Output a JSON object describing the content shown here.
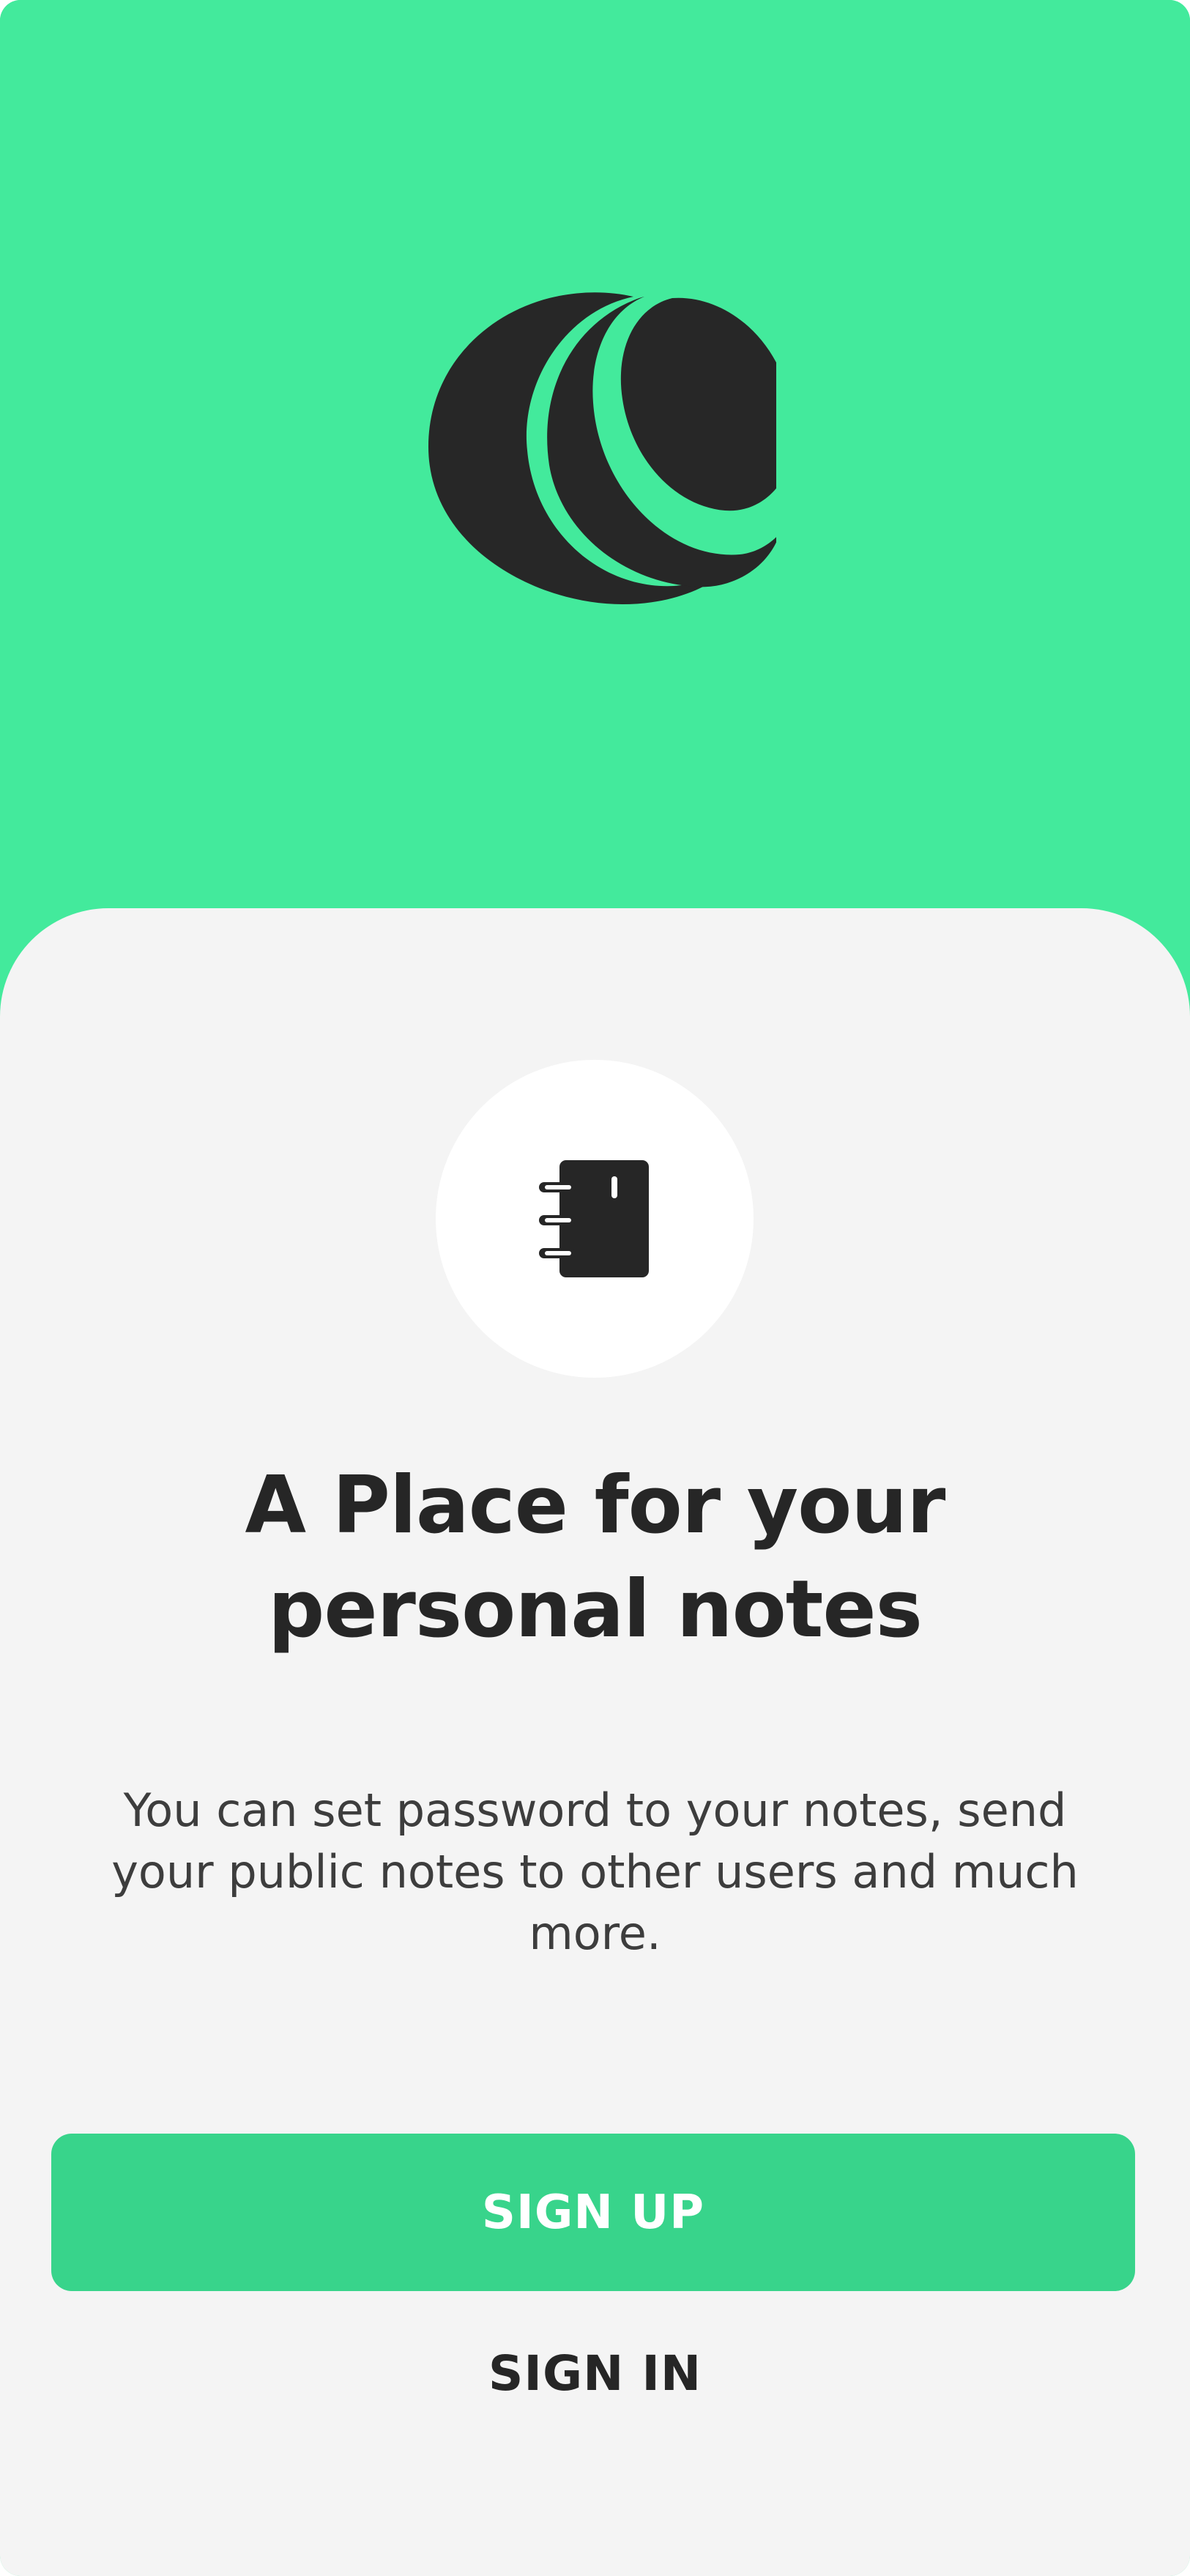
{
  "colors": {
    "brand": "#43ea9c",
    "accent_button": "#38d48b",
    "sheet_background": "#f4f4f4",
    "text_primary": "#262626",
    "text_secondary": "#3d3d3d"
  },
  "hero": {
    "logo_icon": "crescent-globe-logo-icon"
  },
  "onboarding": {
    "feature_icon": "notebook-icon",
    "title": "A Place for your personal notes",
    "description": "You can set password to your notes, send your public notes to other users and much more."
  },
  "actions": {
    "sign_up_label": "SIGN UP",
    "sign_in_label": "SIGN IN"
  }
}
